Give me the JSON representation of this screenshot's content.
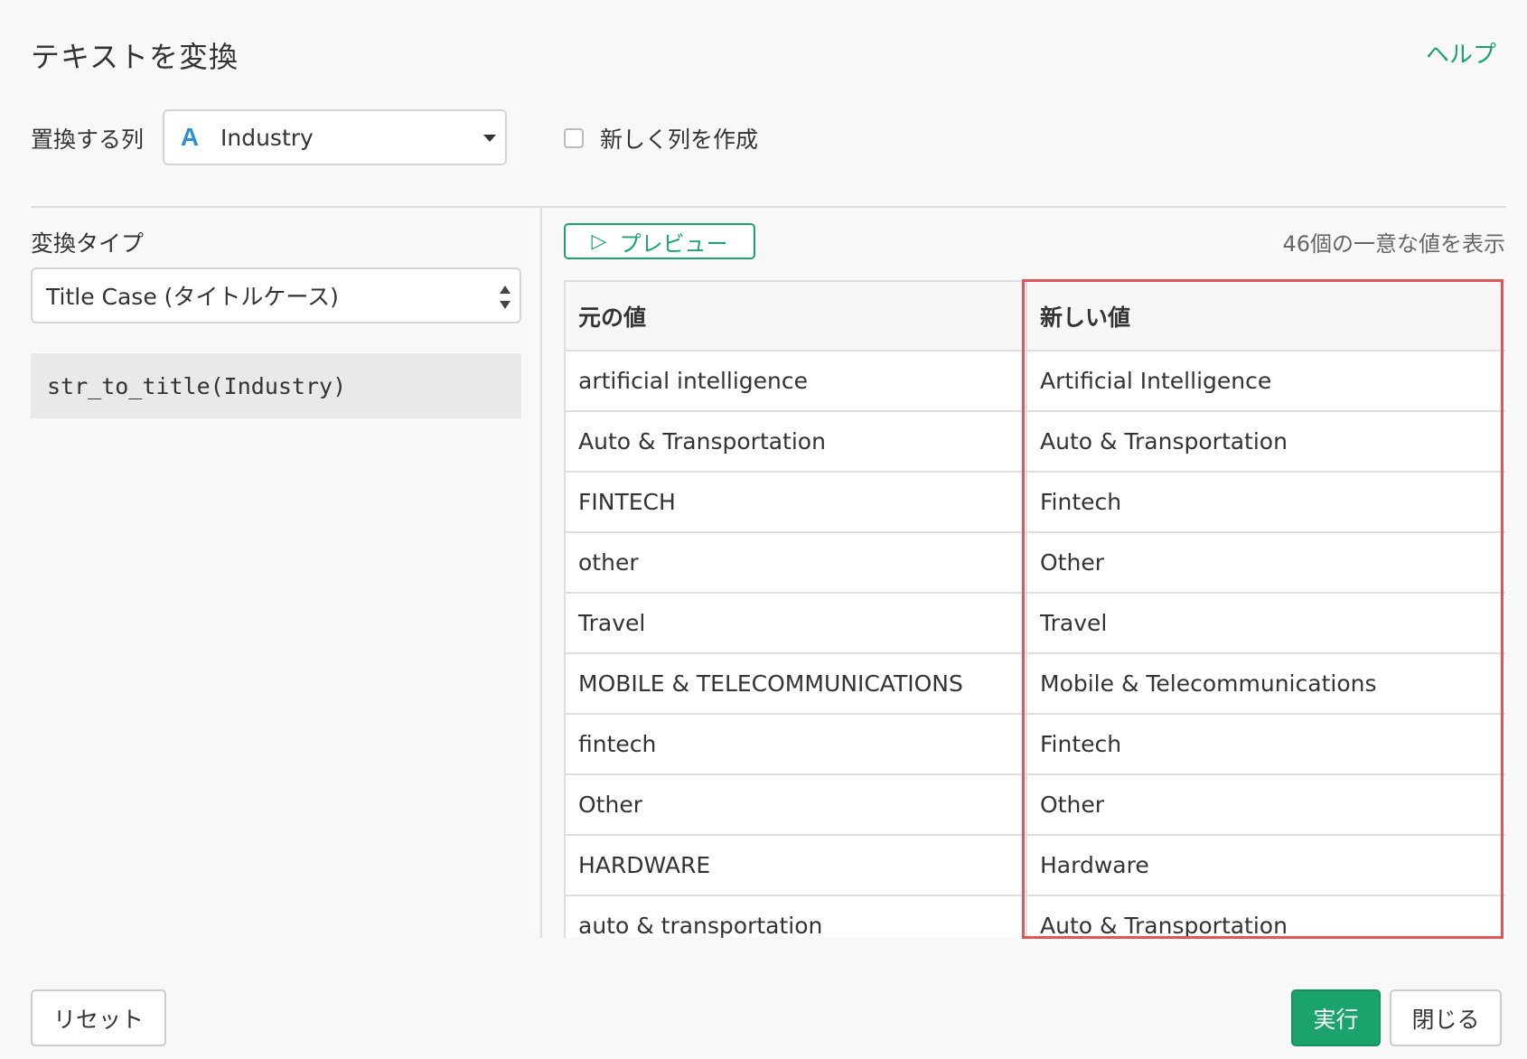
{
  "dialog": {
    "title": "テキストを変換",
    "help_link": "ヘルプ"
  },
  "column_select": {
    "label": "置換する列",
    "type_icon": "A",
    "type_icon_color": "#2d8fd6",
    "value": "Industry"
  },
  "new_column": {
    "label": "新しく列を作成",
    "checked": false
  },
  "conversion": {
    "label": "変換タイプ",
    "selected": "Title Case (タイトルケース)",
    "expression": "str_to_title(Industry)"
  },
  "preview": {
    "button_label": "プレビュー",
    "play_icon": "▷",
    "unique_count_text": "46個の一意な値を表示"
  },
  "table": {
    "headers": [
      "元の値",
      "新しい値"
    ],
    "rows": [
      [
        "artificial intelligence",
        "Artificial Intelligence"
      ],
      [
        "Auto & Transportation",
        "Auto & Transportation"
      ],
      [
        "FINTECH",
        "Fintech"
      ],
      [
        "other",
        "Other"
      ],
      [
        "Travel",
        "Travel"
      ],
      [
        "MOBILE & TELECOMMUNICATIONS",
        "Mobile & Telecommunications"
      ],
      [
        "fintech",
        "Fintech"
      ],
      [
        "Other",
        "Other"
      ],
      [
        "HARDWARE",
        "Hardware"
      ],
      [
        "auto & transportation",
        "Auto & Transportation"
      ]
    ]
  },
  "footer": {
    "reset_label": "リセット",
    "run_label": "実行",
    "close_label": "閉じる"
  },
  "colors": {
    "accent": "#1aa36b",
    "highlight_border": "#e05656"
  }
}
